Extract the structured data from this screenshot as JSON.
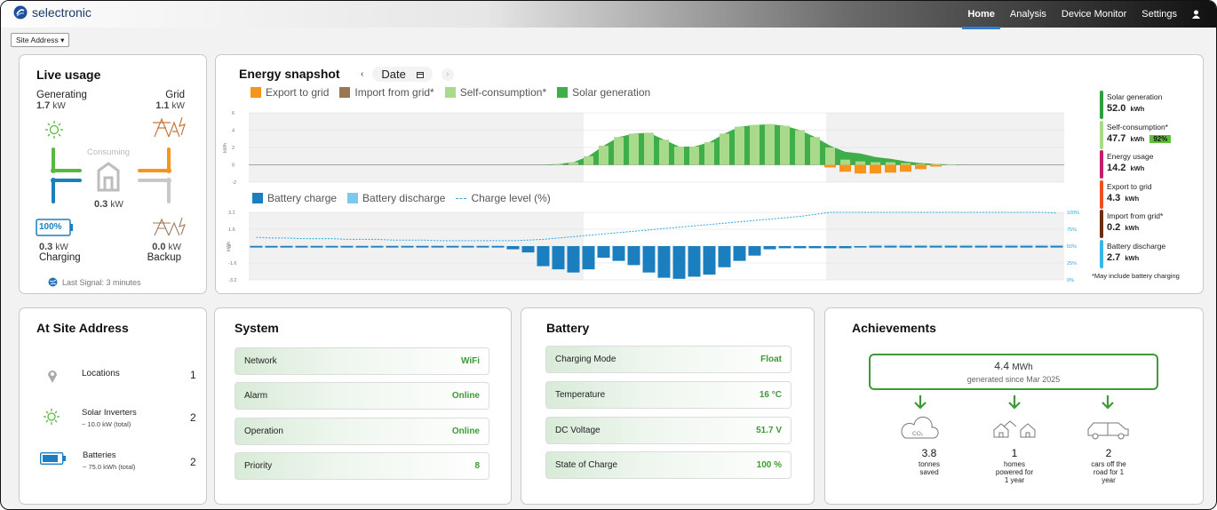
{
  "brand": {
    "name": "selectronic"
  },
  "nav": {
    "home": "Home",
    "analysis": "Analysis",
    "device_monitor": "Device Monitor",
    "settings": "Settings"
  },
  "site_select": "Site Address ▾",
  "live": {
    "title": "Live usage",
    "generating_label": "Generating",
    "generating_value": "1.7",
    "generating_unit": "kW",
    "grid_label": "Grid",
    "grid_value": "1.1",
    "grid_unit": "kW",
    "consuming_label": "Consuming",
    "consuming_value": "0.3",
    "consuming_unit": "kW",
    "battery_pct": "100%",
    "charging_value": "0.3",
    "charging_unit": "kW",
    "charging_label": "Charging",
    "backup_value": "0.0",
    "backup_unit": "kW",
    "backup_label": "Backup",
    "last_signal": "Last Signal: 3 minutes"
  },
  "snapshot": {
    "title": "Energy snapshot",
    "date_label": "Date",
    "legend_top": [
      "Export to grid",
      "Import from grid*",
      "Self-consumption*",
      "Solar generation"
    ],
    "legend_bottom": [
      "Battery charge",
      "Battery discharge",
      "Charge level (%)"
    ],
    "ylabel": "kWh",
    "colors": {
      "export": "#f7941d",
      "import": "#9c7651",
      "self": "#a9d98a",
      "solar": "#3dae49",
      "charge": "#1b7fbf",
      "discharge": "#7ec8f0",
      "level": "#2aa8e0"
    }
  },
  "summary": {
    "items": [
      {
        "name": "Solar generation",
        "value": "52.0",
        "unit": "kWh",
        "color": "#2e9e3e"
      },
      {
        "name": "Self-consumption*",
        "value": "47.7",
        "unit": "kWh",
        "color": "#a9d98a",
        "badge": "92%"
      },
      {
        "name": "Energy usage",
        "value": "14.2",
        "unit": "kWh",
        "color": "#c41d6f"
      },
      {
        "name": "Export to grid",
        "value": "4.3",
        "unit": "kWh",
        "color": "#f04e23"
      },
      {
        "name": "Import from grid*",
        "value": "0.2",
        "unit": "kWh",
        "color": "#6b2e12"
      },
      {
        "name": "Battery discharge",
        "value": "2.7",
        "unit": "kWh",
        "color": "#38b6e8"
      }
    ],
    "footnote": "*May include battery charging"
  },
  "site": {
    "title": "At Site Address",
    "rows": [
      {
        "label": "Locations",
        "sub": "",
        "count": "1"
      },
      {
        "label": "Solar Inverters",
        "sub": "~ 10.0 kW (total)",
        "count": "2"
      },
      {
        "label": "Batteries",
        "sub": "~ 75.0 kWh (total)",
        "count": "2"
      }
    ]
  },
  "system": {
    "title": "System",
    "rows": [
      {
        "label": "Network",
        "value": "WiFi"
      },
      {
        "label": "Alarm",
        "value": "Online"
      },
      {
        "label": "Operation",
        "value": "Online"
      },
      {
        "label": "Priority",
        "value": "8"
      }
    ]
  },
  "battery": {
    "title": "Battery",
    "rows": [
      {
        "label": "Charging Mode",
        "value": "Float"
      },
      {
        "label": "Temperature",
        "value": "16 °C"
      },
      {
        "label": "DC Voltage",
        "value": "51.7 V"
      },
      {
        "label": "State of Charge",
        "value": "100 %"
      }
    ]
  },
  "achievements": {
    "title": "Achievements",
    "total_value": "4.4",
    "total_unit": "MWh",
    "total_desc": "generated since Mar 2025",
    "items": [
      {
        "value": "3.8",
        "desc": "tonnes saved",
        "icon": "co2-cloud-icon"
      },
      {
        "value": "1",
        "desc": "homes powered for 1 year",
        "icon": "houses-icon"
      },
      {
        "value": "2",
        "desc": "cars off the road for 1 year",
        "icon": "car-icon"
      }
    ]
  },
  "chart_data": [
    {
      "type": "bar",
      "ylabel": "kWh",
      "ylim": [
        -2,
        6
      ],
      "yticks": [
        "6",
        "4",
        "2",
        "0",
        "-2"
      ],
      "series": [
        {
          "name": "Solar generation",
          "values": [
            0,
            0,
            0,
            0,
            0,
            0,
            0,
            0,
            0,
            0,
            0,
            0,
            0,
            0,
            0,
            0,
            0,
            0,
            0,
            0,
            0.1,
            0.3,
            1.0,
            2.2,
            3.2,
            3.6,
            3.7,
            2.9,
            2.1,
            2.1,
            2.6,
            3.6,
            4.4,
            4.6,
            4.7,
            4.5,
            4.0,
            3.2,
            2.2,
            1.5,
            1.3,
            0.9,
            0.7,
            0.4,
            0.2,
            0.1,
            0.05,
            0,
            0,
            0,
            0,
            0,
            0,
            0
          ]
        },
        {
          "name": "Self-consumption*",
          "values": [
            0,
            0,
            0,
            0,
            0,
            0,
            0,
            0,
            0,
            0,
            0,
            0,
            0,
            0,
            0,
            0,
            0,
            0,
            0,
            0,
            0.1,
            0.3,
            1.0,
            2.2,
            3.2,
            3.6,
            3.7,
            2.9,
            2.1,
            2.1,
            2.6,
            3.6,
            4.4,
            4.6,
            4.7,
            4.5,
            4.0,
            3.2,
            2.0,
            0.6,
            0.4,
            0.3,
            0.3,
            0.2,
            0.1,
            0.1,
            0.05,
            0,
            0,
            0,
            0,
            0,
            0,
            0
          ]
        },
        {
          "name": "Export to grid",
          "values": [
            0,
            0,
            0,
            0,
            0,
            0,
            0,
            0,
            0,
            0,
            0,
            0,
            0,
            0,
            0,
            0,
            0,
            0,
            0,
            0,
            0,
            0,
            0,
            0,
            0,
            0,
            0,
            0,
            0,
            0,
            0,
            0,
            0,
            0,
            0,
            0,
            0,
            0,
            -0.3,
            -0.8,
            -1.0,
            -1.0,
            -0.9,
            -0.8,
            -0.5,
            -0.2,
            0,
            0,
            0,
            0,
            0,
            0,
            0,
            0
          ]
        },
        {
          "name": "Import from grid*",
          "values": [
            0,
            0,
            0,
            0,
            0,
            0,
            0,
            0,
            0,
            0,
            0,
            0,
            0,
            0,
            0,
            0,
            0,
            0,
            0,
            0,
            0,
            0,
            0,
            0,
            0,
            0,
            0,
            0,
            0,
            0,
            0,
            0,
            0,
            0,
            0,
            0,
            0,
            0,
            0,
            0,
            0,
            0,
            0,
            0,
            0,
            0,
            0,
            0,
            0,
            0,
            0,
            0,
            0,
            0
          ]
        }
      ]
    },
    {
      "type": "bar",
      "ylabel": "kWh",
      "ylim": [
        -3.2,
        3.2
      ],
      "yticks": [
        "3.2",
        "1.6",
        "0",
        "-1.6",
        "-3.2"
      ],
      "y2ticks": [
        "100%",
        "75%",
        "50%",
        "25%",
        "0%"
      ],
      "series": [
        {
          "name": "Battery charge",
          "values": [
            -0.1,
            -0.1,
            -0.1,
            -0.1,
            -0.1,
            -0.1,
            -0.1,
            -0.1,
            -0.1,
            -0.1,
            -0.1,
            -0.1,
            -0.1,
            -0.1,
            -0.1,
            -0.1,
            -0.1,
            -0.3,
            -0.6,
            -1.9,
            -2.2,
            -2.5,
            -2.2,
            -1.1,
            -1.4,
            -1.8,
            -2.5,
            -3.0,
            -3.1,
            -2.9,
            -2.7,
            -2.0,
            -1.4,
            -0.9,
            -0.3,
            -0.2,
            -0.2,
            -0.2,
            -0.2,
            -0.2,
            -0.1,
            -0.1,
            -0.1,
            -0.1,
            -0.1,
            -0.1,
            -0.1,
            -0.1,
            -0.1,
            -0.1,
            -0.1,
            -0.1,
            -0.1,
            -0.1
          ]
        },
        {
          "name": "Battery discharge",
          "values": [
            0.05,
            0.05,
            0.05,
            0.05,
            0.05,
            0.05,
            0.05,
            0.05,
            0.05,
            0.05,
            0.05,
            0.05,
            0.05,
            0.05,
            0.05,
            0.05,
            0.05,
            0,
            0,
            0,
            0,
            0,
            0,
            0,
            0,
            0,
            0,
            0,
            0,
            0,
            0,
            0,
            0,
            0,
            0,
            0,
            0,
            0,
            0,
            0,
            0,
            0.1,
            0.1,
            0.1,
            0.1,
            0.1,
            0.1,
            0.1,
            0.1,
            0.1,
            0.1,
            0.1,
            0.1,
            0.1
          ]
        },
        {
          "name": "Charge level (%)",
          "values": [
            63,
            62,
            62,
            61,
            61,
            61,
            60,
            60,
            60,
            59,
            59,
            59,
            58,
            58,
            58,
            58,
            58,
            58,
            59,
            60,
            62,
            64,
            66,
            68,
            70,
            72,
            74,
            76,
            78,
            80,
            82,
            84,
            86,
            88,
            90,
            92,
            94,
            97,
            100,
            100,
            100,
            100,
            100,
            100,
            100,
            100,
            100,
            100,
            100,
            100,
            100,
            100,
            100,
            99
          ]
        }
      ]
    }
  ]
}
